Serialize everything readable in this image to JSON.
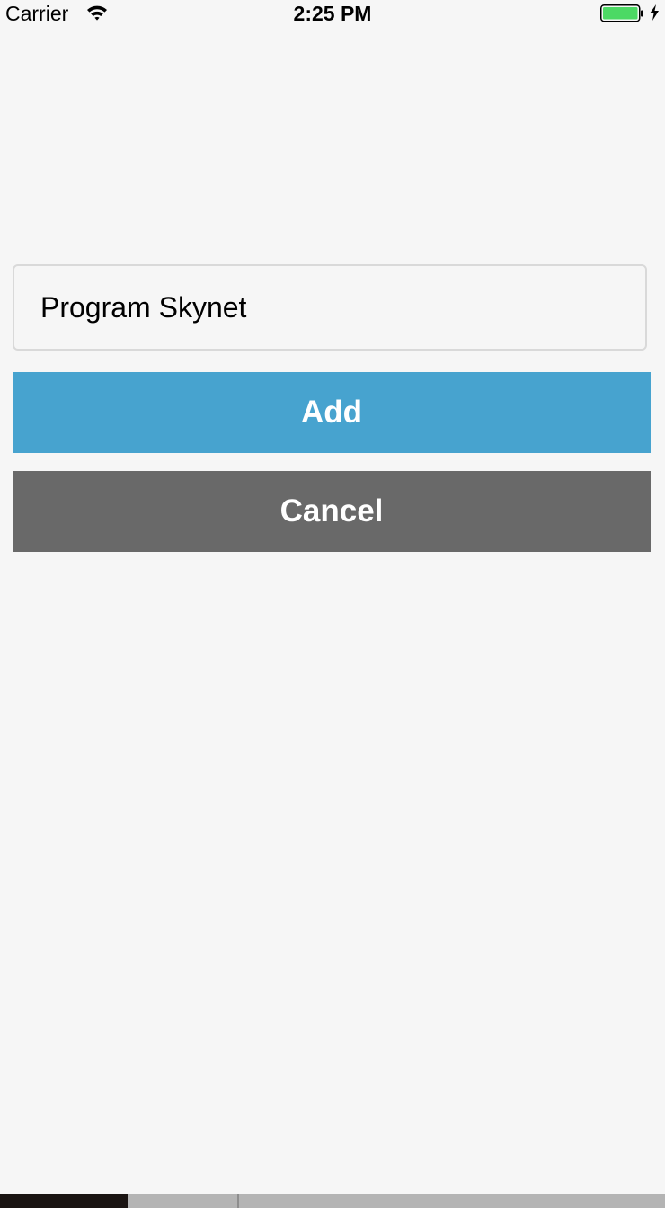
{
  "status_bar": {
    "carrier": "Carrier",
    "time": "2:25 PM",
    "battery_level": 1.0,
    "charging": true,
    "battery_color": "#4cd964"
  },
  "form": {
    "task_value": "Program Skynet",
    "add_label": "Add",
    "cancel_label": "Cancel",
    "add_color": "#47a3cf",
    "cancel_color": "#696969"
  },
  "icons": {
    "wifi": "wifi-icon",
    "battery": "battery-icon",
    "charging": "charging-bolt-icon"
  }
}
